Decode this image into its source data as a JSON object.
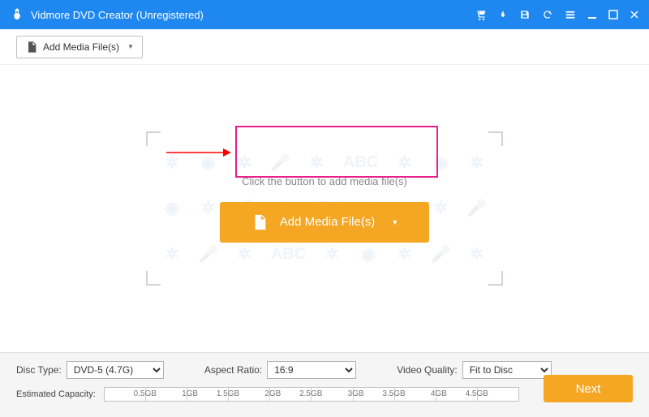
{
  "titlebar": {
    "title": "Vidmore DVD Creator (Unregistered)"
  },
  "toolbar": {
    "add_label": "Add Media File(s)"
  },
  "main": {
    "hint": "Click the button to add media file(s)",
    "add_label": "Add Media File(s)"
  },
  "footer": {
    "disc_type_label": "Disc Type:",
    "disc_type_value": "DVD-5 (4.7G)",
    "aspect_ratio_label": "Aspect Ratio:",
    "aspect_ratio_value": "16:9",
    "video_quality_label": "Video Quality:",
    "video_quality_value": "Fit to Disc",
    "capacity_label": "Estimated Capacity:",
    "ticks": [
      "0.5GB",
      "1GB",
      "1.5GB",
      "2GB",
      "2.5GB",
      "3GB",
      "3.5GB",
      "4GB",
      "4.5GB"
    ],
    "next": "Next"
  }
}
